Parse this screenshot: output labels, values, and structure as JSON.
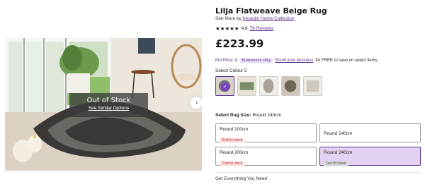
{
  "product": {
    "title": "Lilja Flatweave Beige Rug",
    "see_more_prefix": "See More by",
    "see_more_link": "freundin Home Collection",
    "stars": "★★★★★",
    "rating": "4.8",
    "reviews": "78 Reviews",
    "price": "£223.99"
  },
  "image": {
    "out_of_stock_title": "Out of Stock",
    "see_similar": "See Similar Options",
    "next_icon": "chevron-right-icon"
  },
  "pro": {
    "label": "Pro Price: £",
    "badge": "Businesses Only",
    "enroll_link": "Enroll your business",
    "suffix": "for FREE to save on select items."
  },
  "colour": {
    "label": "Select Colour 5"
  },
  "size": {
    "label_prefix": "Select Rug Size:",
    "label_value": "Round 240cm",
    "options": [
      {
        "name": "Round 100cm",
        "stock": "8 left in stock"
      },
      {
        "name": "Round 140cm",
        "stock": ""
      },
      {
        "name": "Round 200cm",
        "stock": "2 left in stock"
      },
      {
        "name": "Round 240cm",
        "stock": "Out Of Stock"
      }
    ]
  },
  "footer": {
    "get_everything": "Get Everything You Need"
  },
  "colors": {
    "accent": "#5b2f91",
    "selected_bg": "#e4d2f2"
  }
}
